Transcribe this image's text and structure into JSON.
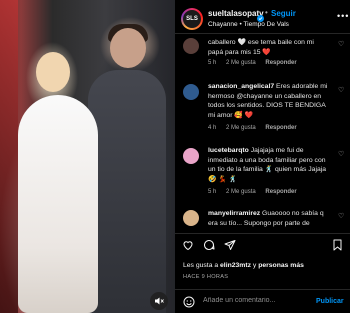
{
  "video": {
    "mute_icon": "speaker-muted-icon"
  },
  "header": {
    "avatar_text": "SLS",
    "username": "sueltalasopatv",
    "verified_icon": "verified-badge-icon",
    "separator": "•",
    "follow_label": "Seguir",
    "audio": "Chayanne • Tiempo De Vals",
    "more_icon": "more-options-icon"
  },
  "comments": [
    {
      "username": "",
      "text": "caballero 🤍 ese tema baile con mi papá para mis 15 ❤️",
      "time": "5 h",
      "likes": "2 Me gusta",
      "reply": "Responder",
      "avatar_color": "#5a3f3a"
    },
    {
      "username": "sanacion_angelical7",
      "text": "Eres adorable mi hermoso @chayanne un caballero en todos los sentidos. DIOS TE BENDIGA mi amor 🥰 ❤️",
      "time": "4 h",
      "likes": "2 Me gusta",
      "reply": "Responder",
      "avatar_color": "#2f5b8f"
    },
    {
      "username": "lucetebarqto",
      "text": "Jajajaja me fui de inmediato a una boda familiar pero con un tio de la familia 🕺 quien más Jajaja 🤣 💃 🕺",
      "time": "5 h",
      "likes": "2 Me gusta",
      "reply": "Responder",
      "avatar_color": "#e9a4c8"
    },
    {
      "username": "manyelirramirez",
      "text": "Guaoooo no sabía q era su tío... Supongo por parte de",
      "avatar_color": "#d9b48a"
    }
  ],
  "actions": {
    "like_icon": "heart-outline-icon",
    "comment_icon": "comment-icon",
    "share_icon": "paper-plane-icon",
    "save_icon": "bookmark-icon"
  },
  "likes": {
    "prefix": "Les gusta a ",
    "user": "elin23mtz",
    "middle": " y ",
    "others": "personas más"
  },
  "time_ago": "HACE 9 HORAS",
  "comment_box": {
    "emoji_icon": "emoji-smile-icon",
    "placeholder": "Añade un comentario...",
    "publish_label": "Publicar"
  },
  "colors": {
    "accent": "#0095f6",
    "background": "#000000",
    "muted": "#a8a8a8"
  }
}
